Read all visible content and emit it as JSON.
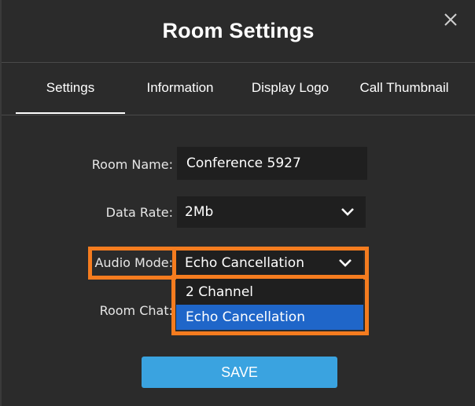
{
  "dialog": {
    "title": "Room Settings",
    "close_icon": "close-icon"
  },
  "tabs": [
    {
      "label": "Settings",
      "active": true
    },
    {
      "label": "Information",
      "active": false
    },
    {
      "label": "Display Logo",
      "active": false
    },
    {
      "label": "Call Thumbnail",
      "active": false
    }
  ],
  "form": {
    "room_name_label": "Room Name:",
    "room_name_value": "Conference 5927",
    "data_rate_label": "Data Rate:",
    "data_rate_value": "2Mb",
    "audio_mode_label": "Audio Mode:",
    "audio_mode_value": "Echo Cancellation",
    "room_chat_label": "Room Chat:",
    "audio_mode_options": [
      "2 Channel",
      "Echo Cancellation"
    ],
    "audio_mode_selected_option": "Echo Cancellation"
  },
  "save_label": "SAVE",
  "colors": {
    "background": "#2b2b2b",
    "field_background": "#1f1f1f",
    "highlight": "#f57c1f",
    "selected_option": "#1f66c9",
    "save_button": "#3aa3e0"
  }
}
